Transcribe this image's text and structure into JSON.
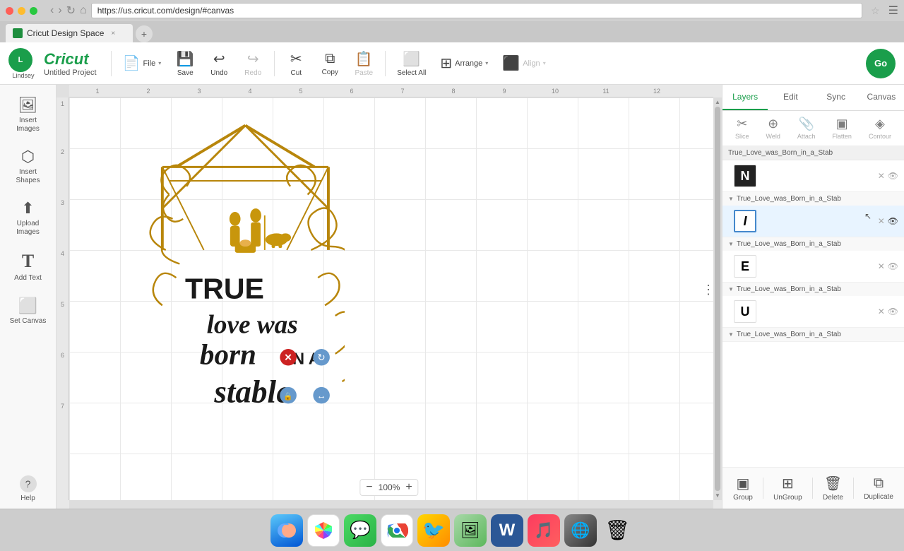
{
  "browser": {
    "url": "https://us.cricut.com/design/#canvas",
    "tab_title": "Cricut Design Space",
    "tab_close": "×"
  },
  "toolbar": {
    "brand": "Cricut",
    "project_name": "Untitled Project",
    "file_label": "File",
    "save_label": "Save",
    "undo_label": "Undo",
    "redo_label": "Redo",
    "cut_label": "Cut",
    "copy_label": "Copy",
    "paste_label": "Paste",
    "select_all_label": "Select All",
    "arrange_label": "Arrange",
    "align_label": "Align",
    "go_label": "Go",
    "user_label": "Lindsey"
  },
  "sidebar": {
    "items": [
      {
        "id": "new",
        "icon": "☰",
        "label": ""
      },
      {
        "id": "insert-images",
        "icon": "🖼",
        "label": "Insert Images"
      },
      {
        "id": "insert-shapes",
        "icon": "⬡",
        "label": "Insert Shapes"
      },
      {
        "id": "upload-images",
        "icon": "⬆",
        "label": "Upload Images"
      },
      {
        "id": "add-text",
        "icon": "T",
        "label": "Add Text"
      },
      {
        "id": "set-canvas",
        "icon": "⬜",
        "label": "Set Canvas"
      },
      {
        "id": "help",
        "icon": "?",
        "label": "Help"
      }
    ]
  },
  "canvas": {
    "zoom_level": "100%",
    "zoom_minus": "−",
    "zoom_plus": "+",
    "ruler_nums_h": [
      "1",
      "2",
      "3",
      "4",
      "5",
      "6",
      "7",
      "8",
      "9",
      "10",
      "11",
      "12"
    ],
    "ruler_nums_v": [
      "1",
      "2",
      "3",
      "4",
      "5",
      "6",
      "7"
    ]
  },
  "right_panel": {
    "tabs": [
      {
        "id": "layers",
        "label": "Layers"
      },
      {
        "id": "edit",
        "label": "Edit"
      },
      {
        "id": "sync",
        "label": "Sync"
      },
      {
        "id": "canvas",
        "label": "Canvas"
      }
    ],
    "tools": [
      {
        "id": "slice",
        "icon": "✂",
        "label": "Slice"
      },
      {
        "id": "weld",
        "icon": "⊕",
        "label": "Weld"
      },
      {
        "id": "attach",
        "icon": "📎",
        "label": "Attach"
      },
      {
        "id": "flatten",
        "icon": "▣",
        "label": "Flatten"
      },
      {
        "id": "contour",
        "icon": "◈",
        "label": "Contour"
      }
    ],
    "layers": [
      {
        "id": "group1",
        "name": "True_Love_was_Born_in_a_Stab",
        "items": [
          {
            "id": "layer-n",
            "thumb_char": "N",
            "bg": "black"
          }
        ]
      },
      {
        "id": "group2",
        "name": "True_Love_was_Born_in_a_Stab",
        "items": [
          {
            "id": "layer-i",
            "thumb_char": "I",
            "bg": "white",
            "selected": true
          }
        ]
      },
      {
        "id": "group3",
        "name": "True_Love_was_Born_in_a_Stab",
        "items": [
          {
            "id": "layer-e",
            "thumb_char": "E",
            "bg": "white"
          }
        ]
      },
      {
        "id": "group4",
        "name": "True_Love_was_Born_in_a_Stab",
        "items": [
          {
            "id": "layer-u",
            "thumb_char": "U",
            "bg": "white"
          }
        ]
      },
      {
        "id": "group5",
        "name": "True_Love_was_Born_in_a_Stab",
        "items": []
      }
    ],
    "footer_btns": [
      {
        "id": "group",
        "icon": "▣",
        "label": "Group"
      },
      {
        "id": "ungroup",
        "icon": "⊞",
        "label": "UnGroup"
      },
      {
        "id": "delete",
        "icon": "🗑",
        "label": "Delete"
      },
      {
        "id": "duplicate",
        "icon": "⧉",
        "label": "Duplicate"
      }
    ]
  }
}
